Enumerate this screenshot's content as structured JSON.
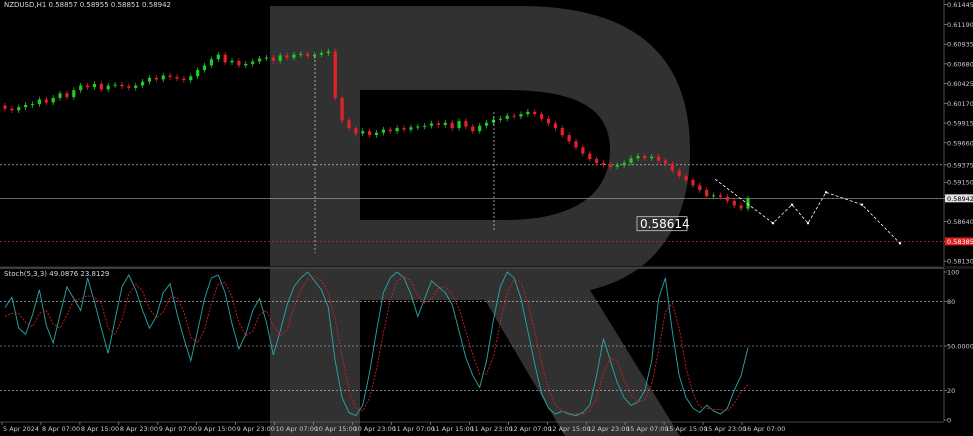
{
  "header": {
    "symbol_info": "NZDUSD,H1  0.58857 0.58955 0.58851 0.58942",
    "stoch_info": "Stoch(5,3,3) 49.0876 23.8129"
  },
  "colors": {
    "background": "#000000",
    "bull": "#22cc22",
    "bear": "#e8202a",
    "stoch_main": "#2aa8a8",
    "stoch_signal": "#d02020",
    "watermark": "#3a3a3a",
    "grid_dash": "#d8d8d8",
    "level_red": "#e02020",
    "forecast": "#ffffff"
  },
  "chart_data": [
    {
      "type": "candlestick",
      "symbol": "NZDUSD",
      "timeframe": "H1",
      "ohlc_current": {
        "open": 0.58857,
        "high": 0.58955,
        "low": 0.58851,
        "close": 0.58942
      },
      "ylim": [
        0.5808,
        0.6148
      ],
      "y_ticks": [
        "0.61445",
        "0.61190",
        "0.60935",
        "0.60680",
        "0.60425",
        "0.60170",
        "0.59915",
        "0.59660",
        "0.59375",
        "0.59150",
        "0.58942",
        "0.58640",
        "0.58385",
        "0.58130"
      ],
      "x_labels": [
        "5 Apr 2024",
        "8 Apr 07:00",
        "8 Apr 15:00",
        "8 Apr 23:00",
        "9 Apr 07:00",
        "9 Apr 15:00",
        "9 Apr 23:00",
        "10 Apr 07:00",
        "10 Apr 15:00",
        "10 Apr 23:00",
        "11 Apr 07:00",
        "11 Apr 15:00",
        "11 Apr 23:00",
        "12 Apr 07:00",
        "12 Apr 15:00",
        "12 Apr 23:00",
        "15 Apr 07:00",
        "15 Apr 15:00",
        "15 Apr 23:00",
        "16 Apr 07:00"
      ],
      "closes": [
        0.601,
        0.6008,
        0.6012,
        0.6015,
        0.6016,
        0.6022,
        0.6018,
        0.6024,
        0.603,
        0.6025,
        0.6034,
        0.604,
        0.6038,
        0.6042,
        0.6035,
        0.604,
        0.6041,
        0.6039,
        0.6037,
        0.604,
        0.6045,
        0.605,
        0.6048,
        0.6053,
        0.6051,
        0.6049,
        0.6047,
        0.6052,
        0.606,
        0.6066,
        0.6074,
        0.608,
        0.607,
        0.6072,
        0.6066,
        0.6068,
        0.6071,
        0.6075,
        0.6076,
        0.6072,
        0.6079,
        0.6076,
        0.608,
        0.6081,
        0.6078,
        0.608,
        0.6082,
        0.6084,
        0.6024,
        0.5995,
        0.5985,
        0.5978,
        0.5981,
        0.5976,
        0.5979,
        0.5983,
        0.5981,
        0.5985,
        0.5983,
        0.5986,
        0.5987,
        0.5988,
        0.5991,
        0.5989,
        0.5992,
        0.5985,
        0.5994,
        0.5987,
        0.5981,
        0.5988,
        0.5992,
        0.5996,
        0.5997,
        0.6001,
        0.6,
        0.6003,
        0.6006,
        0.6003,
        0.5997,
        0.5991,
        0.5985,
        0.5976,
        0.5968,
        0.596,
        0.5952,
        0.5945,
        0.594,
        0.5938,
        0.5935,
        0.5937,
        0.594,
        0.5946,
        0.5949,
        0.5946,
        0.5948,
        0.5943,
        0.5939,
        0.593,
        0.5923,
        0.5918,
        0.5911,
        0.5905,
        0.5897,
        0.5898,
        0.5896,
        0.5891,
        0.5885,
        0.5881,
        0.5894
      ],
      "support_resistance": [
        0.59375,
        0.58942,
        0.58385
      ],
      "annotation_price": "0.58614",
      "current_price_label": "0.58942",
      "level_label": "0.58385",
      "forecast_path": [
        0.5862,
        0.5886,
        0.5862,
        0.5902,
        0.5886,
        0.5836
      ]
    },
    {
      "type": "line",
      "title": "Stoch(5,3,3) 49.0876 23.8129",
      "ylim": [
        0,
        100
      ],
      "levels": [
        20,
        50,
        80
      ],
      "y_ticks": [
        "100",
        "80",
        "50.0000",
        "20",
        "0"
      ],
      "series": [
        {
          "name": "main",
          "values": [
            76,
            83,
            62,
            58,
            71,
            88,
            64,
            52,
            71,
            90,
            82,
            74,
            96,
            80,
            62,
            45,
            68,
            90,
            98,
            88,
            74,
            62,
            70,
            86,
            92,
            72,
            55,
            40,
            60,
            82,
            96,
            98,
            86,
            65,
            48,
            58,
            74,
            82,
            66,
            44,
            60,
            78,
            90,
            96,
            100,
            94,
            88,
            76,
            40,
            15,
            5,
            3,
            10,
            32,
            60,
            86,
            96,
            100,
            96,
            85,
            70,
            82,
            94,
            90,
            86,
            78,
            60,
            42,
            30,
            22,
            40,
            68,
            90,
            100,
            96,
            82,
            60,
            38,
            18,
            8,
            4,
            6,
            4,
            3,
            5,
            10,
            30,
            55,
            40,
            25,
            15,
            10,
            12,
            20,
            40,
            82,
            96,
            60,
            30,
            15,
            8,
            5,
            10,
            6,
            4,
            8,
            20,
            30,
            49
          ]
        },
        {
          "name": "signal",
          "values": [
            70,
            72,
            72,
            66,
            63,
            72,
            74,
            65,
            62,
            71,
            81,
            82,
            84,
            83,
            79,
            62,
            58,
            68,
            85,
            92,
            87,
            75,
            69,
            73,
            83,
            83,
            73,
            56,
            52,
            61,
            79,
            92,
            93,
            83,
            66,
            57,
            60,
            71,
            74,
            64,
            57,
            61,
            76,
            88,
            95,
            97,
            94,
            86,
            68,
            44,
            20,
            8,
            6,
            15,
            34,
            59,
            81,
            94,
            97,
            94,
            84,
            79,
            82,
            89,
            90,
            85,
            75,
            60,
            44,
            31,
            31,
            43,
            66,
            86,
            95,
            93,
            79,
            60,
            39,
            21,
            10,
            6,
            5,
            4,
            4,
            6,
            15,
            32,
            42,
            40,
            27,
            17,
            12,
            14,
            24,
            47,
            73,
            79,
            62,
            35,
            18,
            9,
            8,
            7,
            7,
            6,
            11,
            19,
            24
          ]
        }
      ]
    }
  ],
  "watermark_letter": "R"
}
